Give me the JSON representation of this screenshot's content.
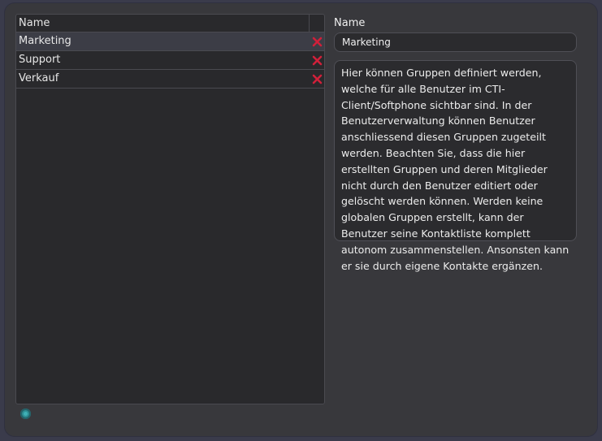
{
  "list": {
    "header": "Name",
    "rows": [
      {
        "name": "Marketing",
        "selected": true
      },
      {
        "name": "Support",
        "selected": false
      },
      {
        "name": "Verkauf",
        "selected": false
      }
    ]
  },
  "detail": {
    "name_label": "Name",
    "name_value": "Marketing",
    "description": "Hier können Gruppen definiert werden, welche für alle Benutzer im CTI-Client/Softphone sichtbar sind. In der Benutzerverwaltung können Benutzer anschliessend diesen Gruppen zugeteilt werden. Beachten Sie, dass die hier erstellten Gruppen und deren Mitglieder nicht durch den Benutzer editiert oder gelöscht werden können. Werden keine globalen Gruppen erstellt, kann der Benutzer seine Kontaktliste komplett autonom zusammenstellen. Ansonsten kann er sie durch eigene Kontakte ergänzen."
  },
  "icons": {
    "delete": "delete-x-icon",
    "add": "add-circle-icon"
  },
  "colors": {
    "delete": "#d0203a",
    "add": "#2f8f95",
    "selected_row": "#3c3d46"
  }
}
